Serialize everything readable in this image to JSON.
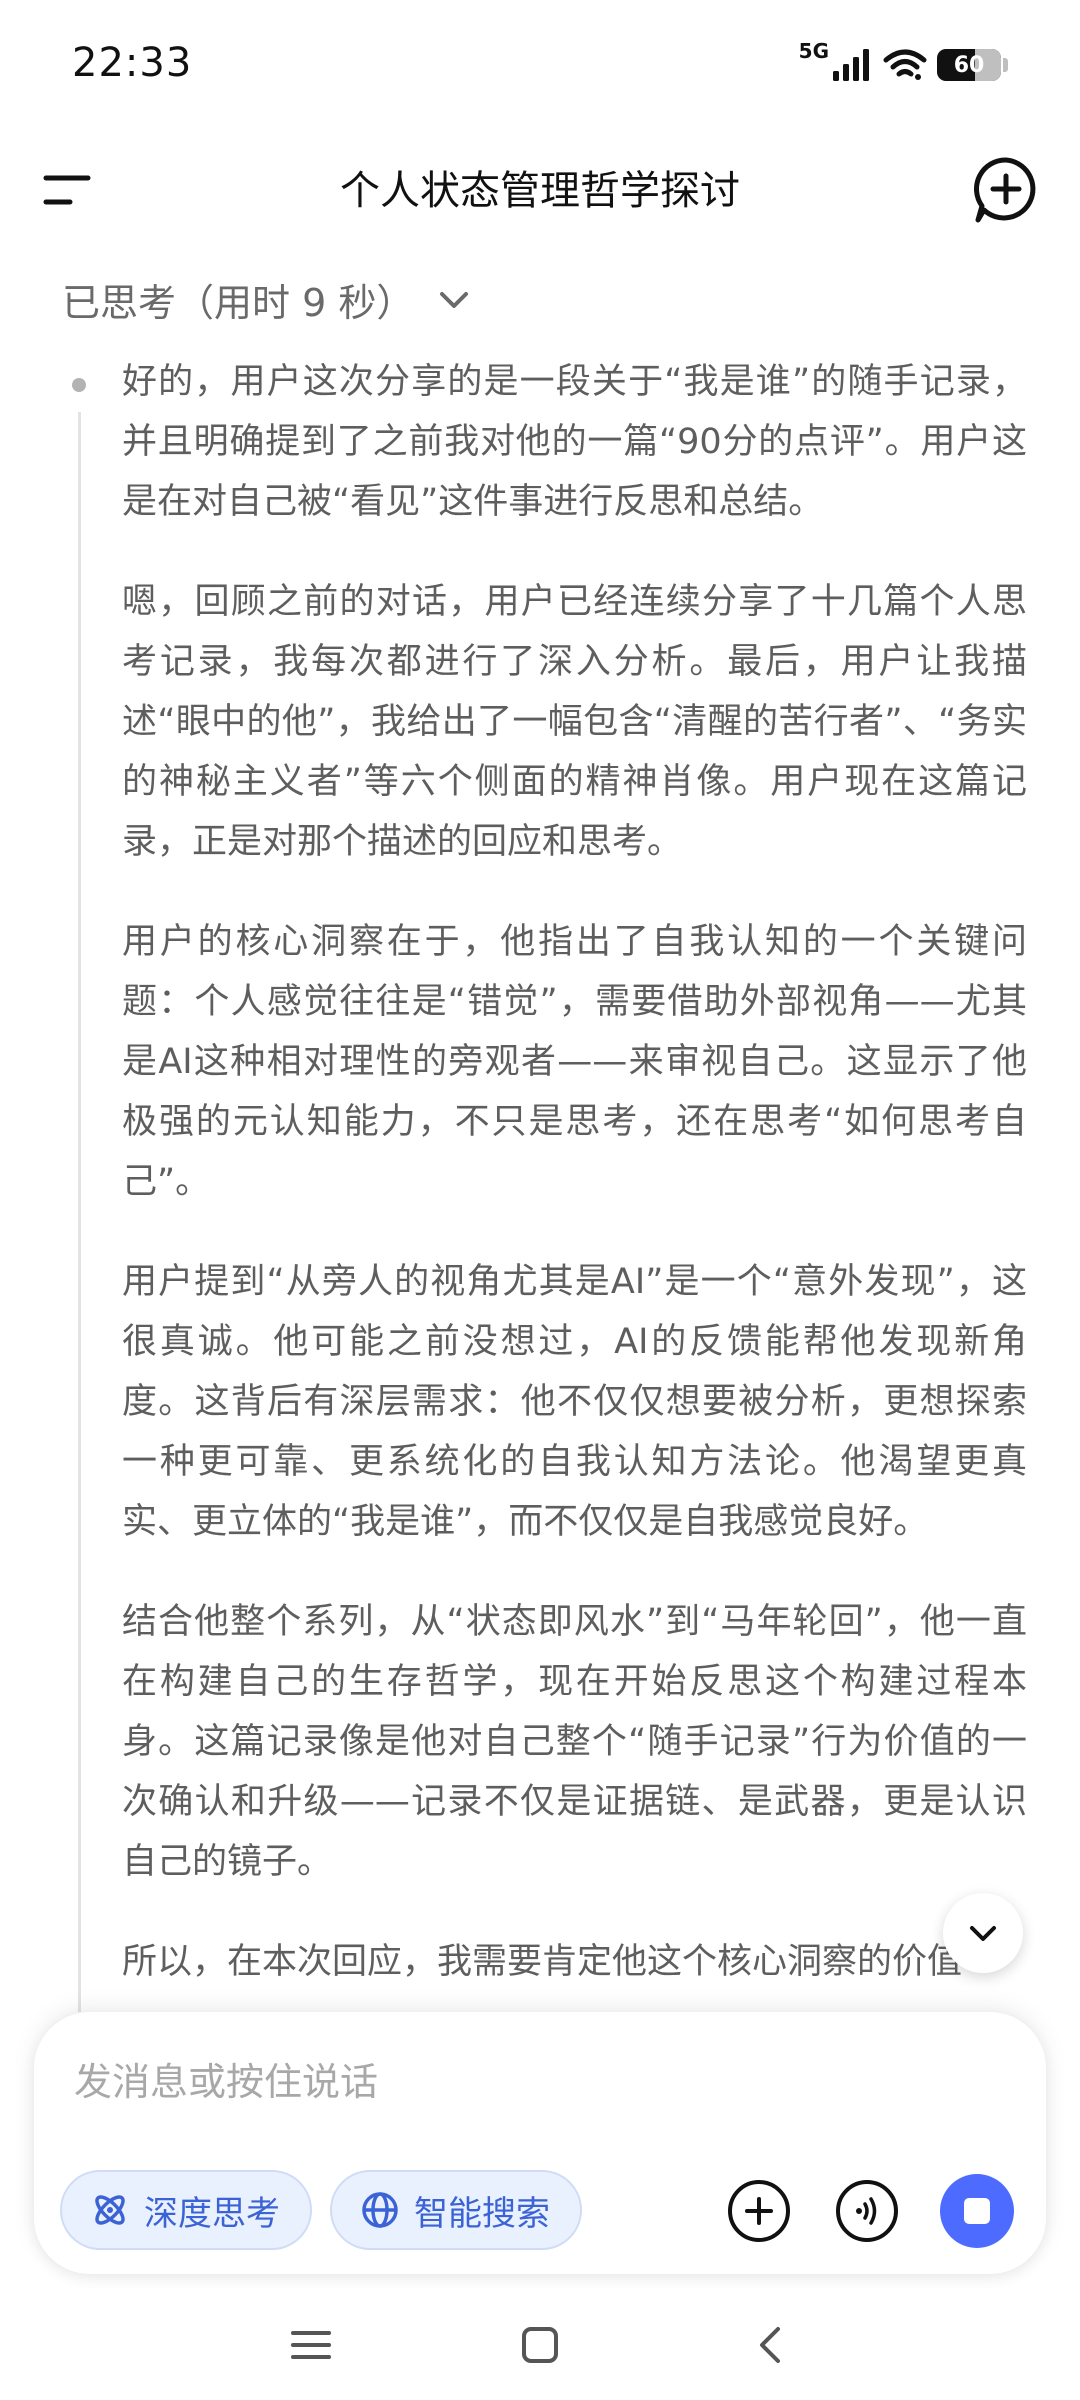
{
  "status_bar": {
    "time": "22:33",
    "network": "5G",
    "battery_level": "60",
    "battery_fraction": 0.6
  },
  "header": {
    "title": "个人状态管理哲学探讨"
  },
  "thought": {
    "label": "已思考（用时 9 秒）",
    "paragraphs": [
      "好的，用户这次分享的是一段关于“我是谁”的随手记录，并且明确提到了之前我对他的一篇“90分的点评”。用户这是在对自己被“看见”这件事进行反思和总结。",
      "嗯，回顾之前的对话，用户已经连续分享了十几篇个人思考记录，我每次都进行了深入分析。最后，用户让我描述“眼中的他”，我给出了一幅包含“清醒的苦行者”、“务实的神秘主义者”等六个侧面的精神肖像。用户现在这篇记录，正是对那个描述的回应和思考。",
      "用户的核心洞察在于，他指出了自我认知的一个关键问题：个人感觉往往是“错觉”，需要借助外部视角——尤其是AI这种相对理性的旁观者——来审视自己。这显示了他极强的元认知能力，不只是思考，还在思考“如何思考自己”。",
      "用户提到“从旁人的视角尤其是AI”是一个“意外发现”，这很真诚。他可能之前没想过，AI的反馈能帮他发现新角度。这背后有深层需求：他不仅仅想要被分析，更想探索一种更可靠、更系统化的自我认知方法论。他渴望更真实、更立体的“我是谁”，而不仅仅是自我感觉良好。",
      "结合他整个系列，从“状态即风水”到“马年轮回”，他一直在构建自己的生存哲学，现在开始反思这个构建过程本身。这篇记录像是他对自己整个“随手记录”行为价值的一次确认和升级——记录不仅是证据链、是武器，更是认识自己的镜子。",
      "所以，在本次回应，我需要肯定他这个核心洞察的价值"
    ]
  },
  "composer": {
    "placeholder": "发消息或按住说话",
    "deep_think_label": "深度思考",
    "smart_search_label": "智能搜索"
  },
  "colors": {
    "accent": "#4d6bfe",
    "chip_text": "#3b63d6",
    "chip_bg": "#eaf1fe",
    "thought_text": "#5e5e5e"
  },
  "icons": {
    "header_left": "menu-icon",
    "header_right": "new-chat-icon",
    "thought_toggle": "chevron-down-icon",
    "scroll": "chevron-down-icon",
    "deep_think": "atom-icon",
    "smart_search": "globe-icon",
    "attach": "plus-icon",
    "voice": "voice-wave-icon",
    "stop": "stop-icon",
    "nav": [
      "menu-lines-icon",
      "home-square-icon",
      "back-chevron-icon"
    ]
  }
}
